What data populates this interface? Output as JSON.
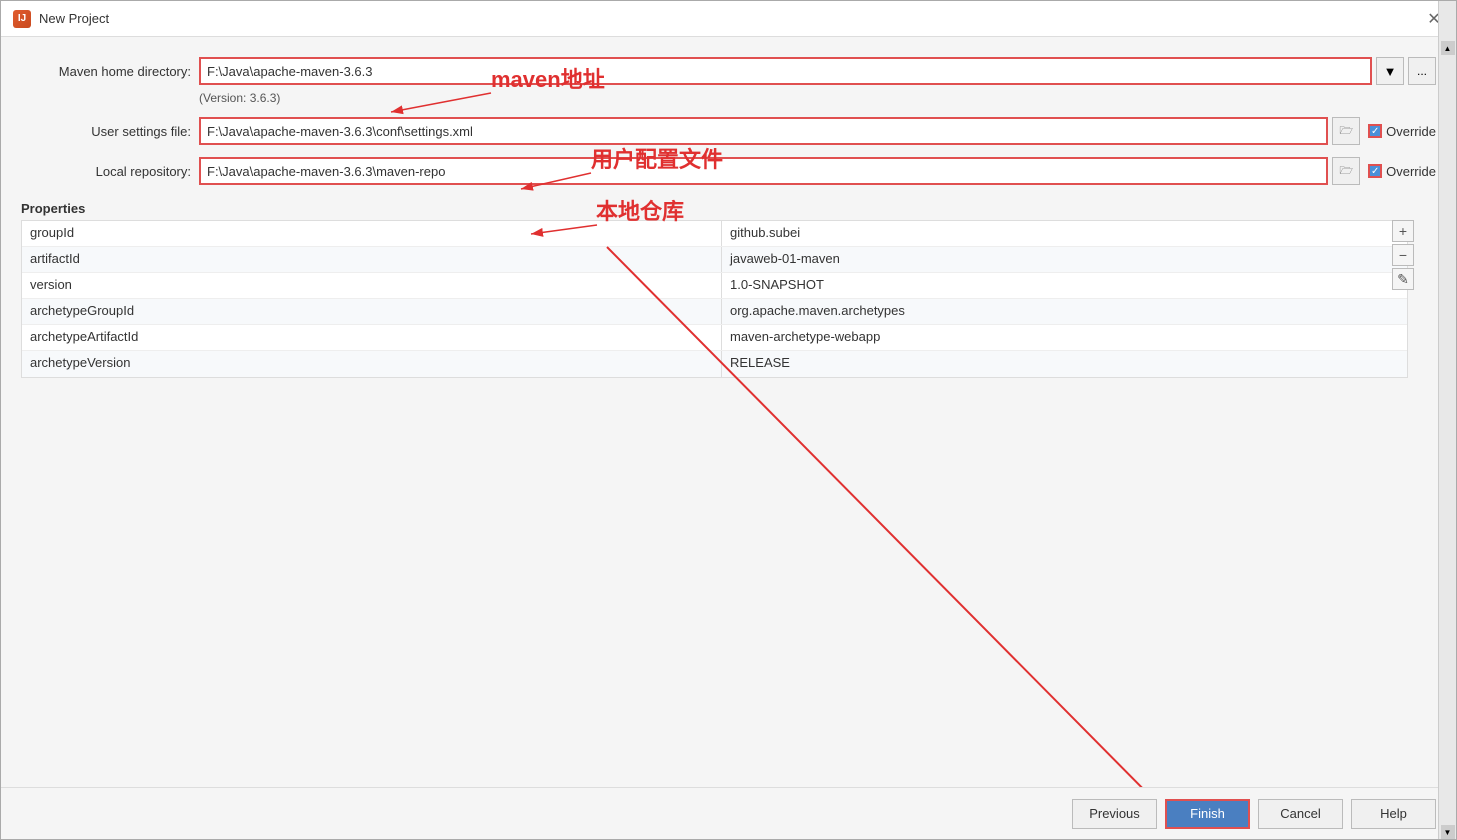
{
  "dialog": {
    "title": "New Project",
    "app_icon_text": "IJ"
  },
  "form": {
    "maven_home_label": "Maven home directory:",
    "maven_home_value": "F:\\Java\\apache-maven-3.6.3",
    "maven_home_version": "(Version: 3.6.3)",
    "user_settings_label": "User settings file:",
    "user_settings_value": "F:\\Java\\apache-maven-3.6.3\\conf\\settings.xml",
    "local_repo_label": "Local repository:",
    "local_repo_value": "F:\\Java\\apache-maven-3.6.3\\maven-repo",
    "override_label": "Override",
    "dropdown_symbol": "▼",
    "ellipsis_symbol": "..."
  },
  "annotations": {
    "maven_addr_label": "maven地址",
    "user_settings_label": "用户配置文件",
    "local_repo_label": "本地仓库"
  },
  "properties": {
    "section_title": "Properties",
    "add_symbol": "+",
    "remove_symbol": "−",
    "edit_symbol": "✎",
    "rows": [
      {
        "key": "groupId",
        "value": "github.subei"
      },
      {
        "key": "artifactId",
        "value": "javaweb-01-maven"
      },
      {
        "key": "version",
        "value": "1.0-SNAPSHOT"
      },
      {
        "key": "archetypeGroupId",
        "value": "org.apache.maven.archetypes"
      },
      {
        "key": "archetypeArtifactId",
        "value": "maven-archetype-webapp"
      },
      {
        "key": "archetypeVersion",
        "value": "RELEASE"
      }
    ]
  },
  "buttons": {
    "previous_label": "Previous",
    "finish_label": "Finish",
    "cancel_label": "Cancel",
    "help_label": "Help"
  }
}
